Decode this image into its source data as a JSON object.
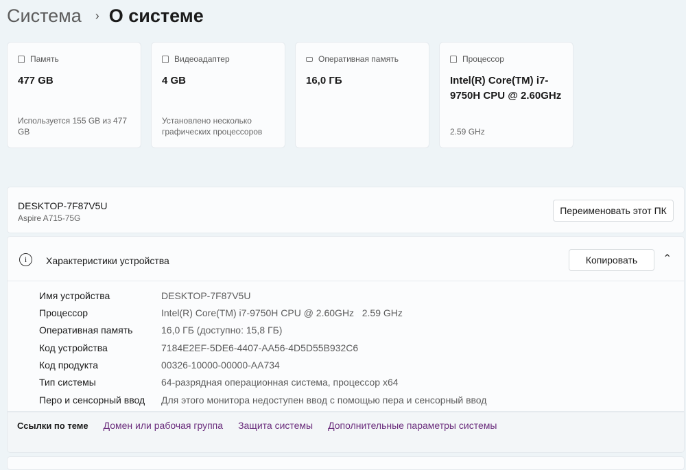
{
  "breadcrumb": {
    "parent": "Система",
    "current": "О системе"
  },
  "cards": [
    {
      "title": "Память",
      "value": "477 GB",
      "sub": "Используется 155 GB из 477 GB"
    },
    {
      "title": "Видеоадаптер",
      "value": "4 GB",
      "sub": "Установлено несколько графических процессоров"
    },
    {
      "title": "Оперативная память",
      "value": "16,0 ГБ",
      "sub": ""
    },
    {
      "title": "Процессор",
      "value": "Intel(R) Core(TM) i7-9750H CPU @ 2.60GHz",
      "sub": "2.59 GHz"
    }
  ],
  "device": {
    "name": "DESKTOP-7F87V5U",
    "model": "Aspire A715-75G",
    "rename": "Переименовать этот ПК"
  },
  "specs": {
    "title": "Характеристики устройства",
    "copy": "Копировать",
    "rows": [
      {
        "k": "Имя устройства",
        "v": "DESKTOP-7F87V5U"
      },
      {
        "k": "Процессор",
        "v": "Intel(R) Core(TM) i7-9750H CPU @ 2.60GHz   2.59 GHz"
      },
      {
        "k": "Оперативная память",
        "v": "16,0 ГБ (доступно: 15,8 ГБ)"
      },
      {
        "k": "Код устройства",
        "v": "7184E2EF-5DE6-4407-AA56-4D5D55B932C6"
      },
      {
        "k": "Код продукта",
        "v": "00326-10000-00000-AA734"
      },
      {
        "k": "Тип системы",
        "v": "64-разрядная операционная система, процессор x64"
      },
      {
        "k": "Перо и сенсорный ввод",
        "v": "Для этого монитора недоступен ввод с помощью пера и сенсорный ввод"
      }
    ]
  },
  "links": {
    "label": "Ссылки по теме",
    "items": [
      "Домен или рабочая группа",
      "Защита системы",
      "Дополнительные параметры системы"
    ]
  }
}
